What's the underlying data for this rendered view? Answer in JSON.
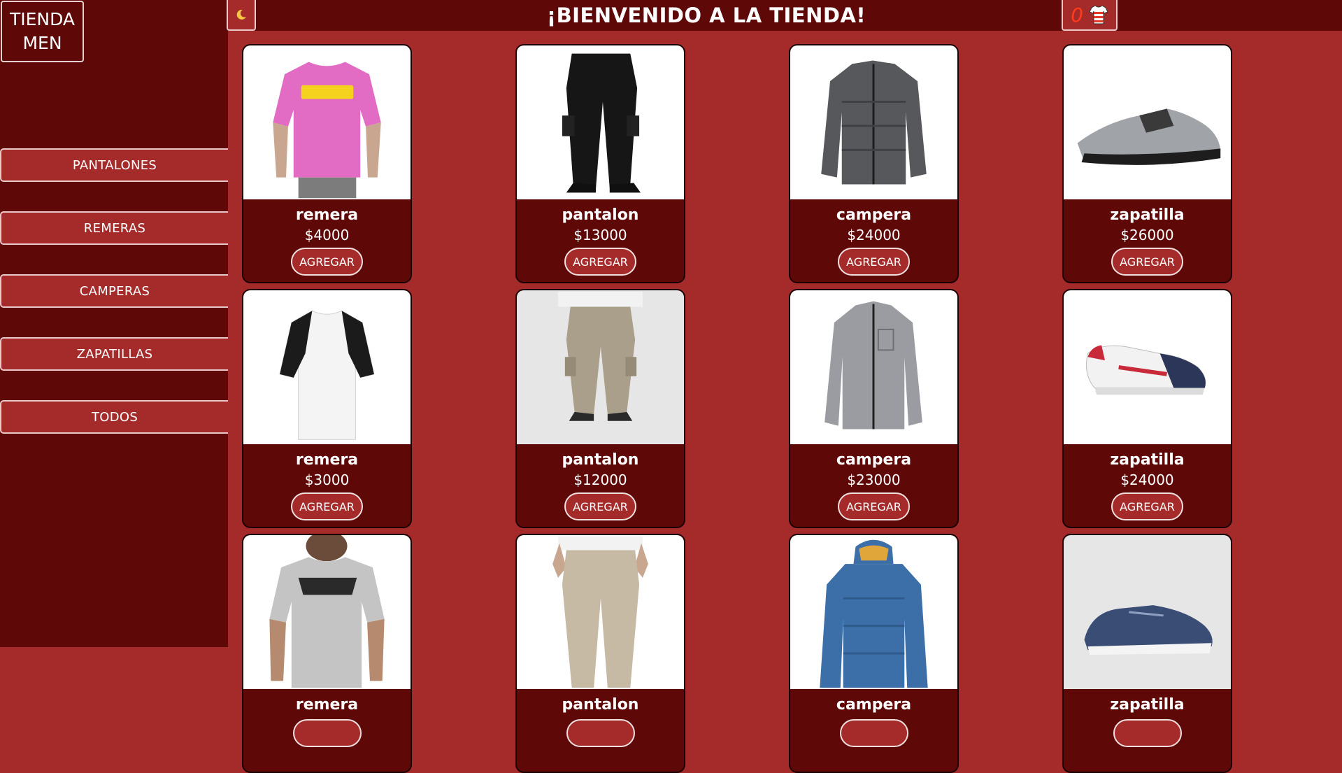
{
  "brand": {
    "line1": "TIENDA",
    "line2": "MEN"
  },
  "header": {
    "title": "¡BIENVENIDO A LA TIENDA!",
    "theme_icon": "moon-icon",
    "cart_count": "0",
    "cart_icon": "shirt-icon"
  },
  "categories": [
    {
      "label": "PANTALONES"
    },
    {
      "label": "REMERAS"
    },
    {
      "label": "CAMPERAS"
    },
    {
      "label": "ZAPATILLAS"
    },
    {
      "label": "TODOS"
    }
  ],
  "colors": {
    "background": "#a52a2a",
    "dark": "#5f0808",
    "cart_count": "#ff3b1a"
  },
  "products": [
    {
      "name": "remera",
      "price": "$4000",
      "button": "AGREGAR",
      "image": "pink-tshirt"
    },
    {
      "name": "pantalon",
      "price": "$13000",
      "button": "AGREGAR",
      "image": "black-cargo-pants"
    },
    {
      "name": "campera",
      "price": "$24000",
      "button": "AGREGAR",
      "image": "grey-puffer-jacket"
    },
    {
      "name": "zapatilla",
      "price": "$26000",
      "button": "AGREGAR",
      "image": "silver-sneaker"
    },
    {
      "name": "remera",
      "price": "$3000",
      "button": "AGREGAR",
      "image": "white-raglan-tshirt"
    },
    {
      "name": "pantalon",
      "price": "$12000",
      "button": "AGREGAR",
      "image": "khaki-cargo-pants"
    },
    {
      "name": "campera",
      "price": "$23000",
      "button": "AGREGAR",
      "image": "grey-fleece-jacket"
    },
    {
      "name": "zapatilla",
      "price": "$24000",
      "button": "AGREGAR",
      "image": "white-navy-sneaker"
    },
    {
      "name": "remera",
      "price": "",
      "button": "",
      "image": "grey-vans-tshirt"
    },
    {
      "name": "pantalon",
      "price": "",
      "button": "",
      "image": "beige-chinos"
    },
    {
      "name": "campera",
      "price": "",
      "button": "",
      "image": "blue-hooded-jacket"
    },
    {
      "name": "zapatilla",
      "price": "",
      "button": "",
      "image": "navy-running-shoe"
    }
  ]
}
